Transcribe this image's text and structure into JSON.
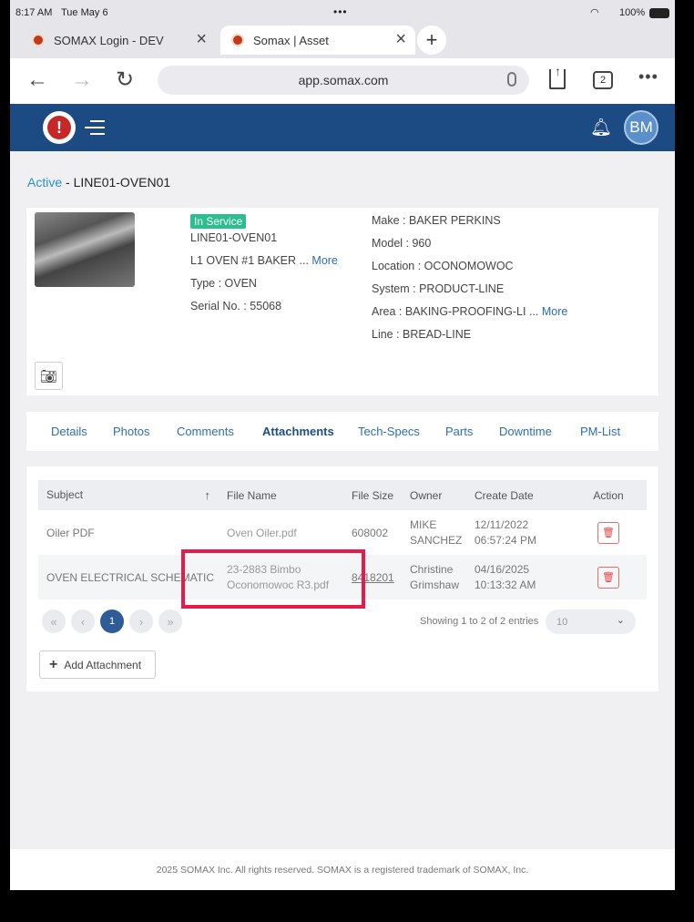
{
  "status_bar": {
    "time": "8:17 AM",
    "date": "Tue May 6",
    "battery": "100%"
  },
  "browser": {
    "tabs": [
      {
        "title": "SOMAX Login - DEV"
      },
      {
        "title": "Somax | Asset"
      }
    ],
    "url": "app.somax.com",
    "tab_count": "2"
  },
  "app": {
    "avatar_initials": "BM"
  },
  "breadcrumb": {
    "active": "Active",
    "separator": " - ",
    "current": "LINE01-OVEN01"
  },
  "asset": {
    "status": "In Service",
    "id": "LINE01-OVEN01",
    "description": "L1 OVEN #1 BAKER ...",
    "description_more": "More",
    "type": "Type : OVEN",
    "serial": "Serial No. : 55068",
    "make": "Make : BAKER PERKINS",
    "model": "Model : 960",
    "location": "Location : OCONOMOWOC",
    "system": "System : PRODUCT-LINE",
    "area": "Area : BAKING-PROOFING-LI ...",
    "area_more": "More",
    "line": "Line : BREAD-LINE"
  },
  "detail_tabs": [
    "Details",
    "Photos",
    "Comments",
    "Attachments",
    "Tech-Specs",
    "Parts",
    "Downtime",
    "PM-List"
  ],
  "attachments": {
    "columns": [
      "Subject",
      "File Name",
      "File Size",
      "Owner",
      "Create Date",
      "Action"
    ],
    "sort_indicator": "↑",
    "rows": [
      {
        "subject": "Oiler PDF",
        "file_name": "Oven Oiler.pdf",
        "file_size": "608002",
        "owner": "MIKE SANCHEZ",
        "create_date": "12/11/2022 06:57:24 PM"
      },
      {
        "subject": "OVEN ELECTRICAL SCHEMATIC",
        "file_name": "23-2883 Bimbo Oconomowoc R3.pdf",
        "file_size": "8418201",
        "owner": "Christine Grimshaw",
        "create_date": "04/16/2025 10:13:32 AM"
      }
    ],
    "current_page": "1",
    "showing": "Showing 1 to 2 of 2 entries",
    "page_size": "10",
    "add_button": "Add Attachment"
  },
  "footer": "2025 SOMAX Inc. All rights reserved. SOMAX is a registered trademark of SOMAX, Inc.",
  "colors": {
    "header": "#1c4a83",
    "accent": "#2a8fcf",
    "badge": "#2bbf8f",
    "highlight": "#e8194b"
  }
}
